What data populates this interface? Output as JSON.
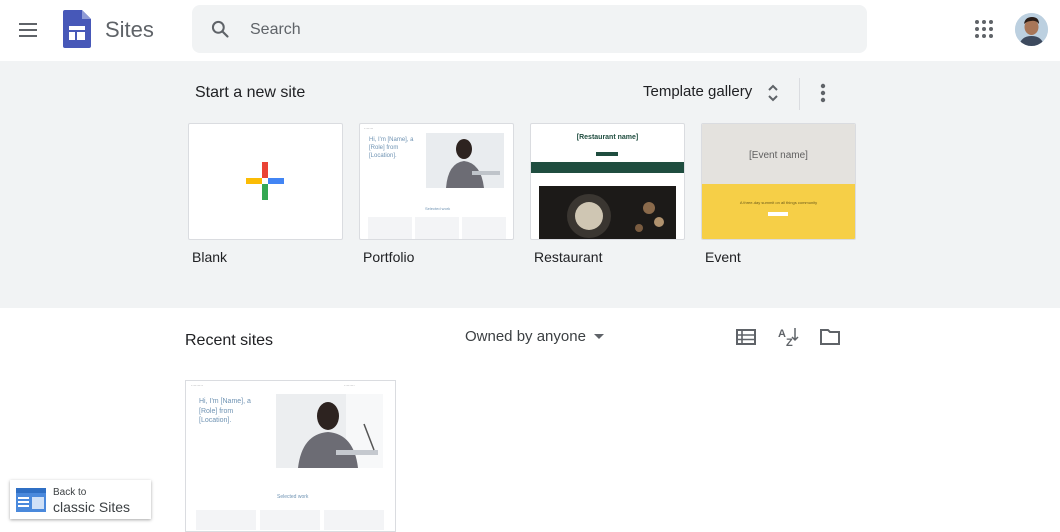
{
  "header": {
    "app_title": "Sites",
    "search_placeholder": "Search"
  },
  "gallery": {
    "title": "Start a new site",
    "template_gallery_label": "Template gallery",
    "templates": [
      {
        "label": "Blank"
      },
      {
        "label": "Portfolio",
        "preview_text": "Hi, I'm [Name], a [Role] from [Location].",
        "preview_link": "Selected work"
      },
      {
        "label": "Restaurant",
        "preview_text": "[Restaurant name]"
      },
      {
        "label": "Event",
        "preview_text": "[Event name]",
        "preview_sub": "A three-day summit on all things community"
      }
    ]
  },
  "recent": {
    "title": "Recent sites",
    "owner_filter": "Owned by anyone",
    "sites": [
      {
        "preview_text": "Hi, I'm [Name], a [Role] from [Location].",
        "preview_link": "Selected work"
      }
    ]
  },
  "back_classic": {
    "line1": "Back to",
    "line2": "classic Sites"
  },
  "colors": {
    "gallery_bg": "#f1f3f4",
    "sites_blue": "#4758b8",
    "restaurant_green": "#1f4d3f",
    "event_yellow": "#f6cf47",
    "portfolio_accent": "#6f93b3"
  }
}
